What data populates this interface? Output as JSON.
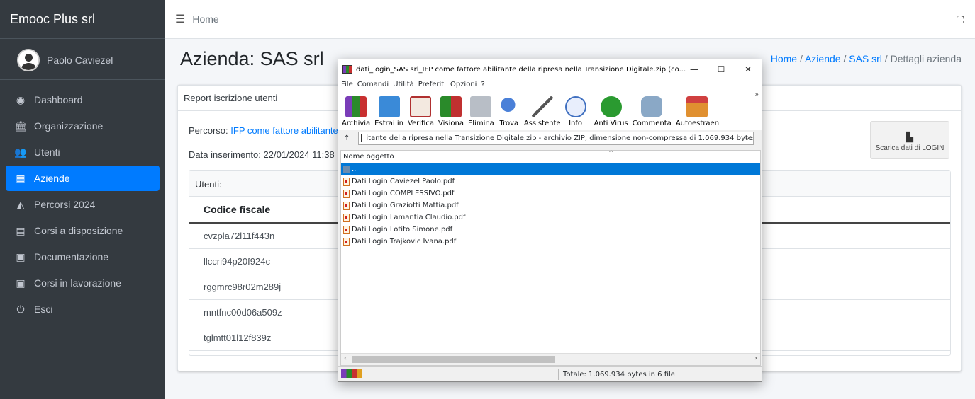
{
  "sidebar": {
    "brand": "Emooc Plus srl",
    "user": "Paolo Caviezel",
    "items": [
      {
        "label": "Dashboard",
        "icon": "dashboard-icon"
      },
      {
        "label": "Organizzazione",
        "icon": "bank-icon"
      },
      {
        "label": "Utenti",
        "icon": "users-icon"
      },
      {
        "label": "Aziende",
        "icon": "building-icon"
      },
      {
        "label": "Percorsi 2024",
        "icon": "binoculars-icon"
      },
      {
        "label": "Corsi a disposizione",
        "icon": "book-icon"
      },
      {
        "label": "Documentazione",
        "icon": "pdf-file-icon"
      },
      {
        "label": "Corsi in lavorazione",
        "icon": "excel-file-icon"
      },
      {
        "label": "Esci",
        "icon": "power-icon"
      }
    ]
  },
  "topbar": {
    "home": "Home"
  },
  "page": {
    "title": "Azienda: SAS srl",
    "breadcrumb": {
      "home": "Home",
      "aziende": "Aziende",
      "company": "SAS srl",
      "current": "Dettagli azienda"
    },
    "card_header": "Report iscrizione utenti",
    "percorso_label": "Percorso:",
    "percorso_link": "IFP come fattore abilitante",
    "data_inserimento": "Data inserimento: 22/01/2024 11:38",
    "download_button": "Scarica dati di LOGIN",
    "users_header": "Utenti:",
    "table_header": "Codice fiscale",
    "rows": [
      "cvzpla72l11f443n",
      "llccri94p20f924c",
      "rggmrc98r02m289j",
      "mntfnc00d06a509z",
      "tglmtt01l12f839z"
    ]
  },
  "winrar": {
    "title": "dati_login_SAS srl_IFP come fattore abilitante della ripresa nella Transizione Digitale.zip (co...",
    "menu": [
      "File",
      "Comandi",
      "Utilità",
      "Preferiti",
      "Opzioni",
      "?"
    ],
    "tools": [
      {
        "label": "Archivia",
        "color": "#c04040"
      },
      {
        "label": "Estrai in",
        "color": "#3a8ad8"
      },
      {
        "label": "Verifica",
        "color": "#b03030"
      },
      {
        "label": "Visiona",
        "color": "#2a8a2a"
      },
      {
        "label": "Elimina",
        "color": "#9aa0a8"
      },
      {
        "label": "Trova",
        "color": "#3060c0"
      },
      {
        "label": "Assistente",
        "color": "#9a7ab0"
      },
      {
        "label": "Info",
        "color": "#4070c0"
      },
      {
        "label": "Anti Virus",
        "color": "#2a9a30"
      },
      {
        "label": "Commenta",
        "color": "#6a8aa8"
      },
      {
        "label": "Autoestraen",
        "color": "#e09030"
      }
    ],
    "path": "itante della ripresa nella Transizione Digitale.zip - archivio ZIP, dimensione non-compressa di 1.069.934 bytes",
    "column": "Nome oggetto",
    "parent": "..",
    "files": [
      "Dati Login Caviezel Paolo.pdf",
      "Dati Login COMPLESSIVO.pdf",
      "Dati Login Graziotti Mattia.pdf",
      "Dati Login Lamantia Claudio.pdf",
      "Dati Login Lotito Simone.pdf",
      "Dati Login Trajkovic Ivana.pdf"
    ],
    "status": "Totale: 1.069.934 bytes in 6 file"
  }
}
